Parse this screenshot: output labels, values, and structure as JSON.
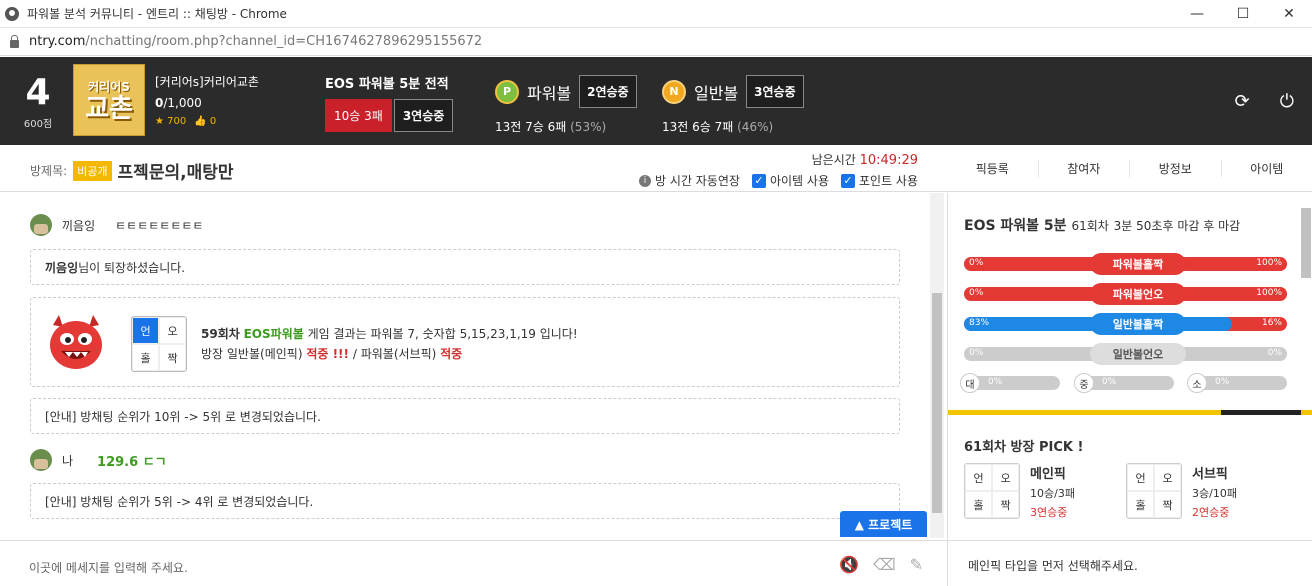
{
  "window": {
    "title": "파워볼 분석 커뮤니티 - 엔트리 :: 채팅방 - Chrome",
    "min": "—",
    "max": "☐",
    "close": "✕"
  },
  "address": {
    "host": "ntry.com",
    "path": "/nchatting/room.php?channel_id=CH1674627896295155672"
  },
  "header": {
    "rank": "4",
    "points": "600점",
    "logo_top": "커리어S",
    "logo_main": "교촌",
    "club_name": "[커리어s]커리어교촌",
    "members_cur": "0",
    "members_max": "/1,000",
    "stars": "★ 700",
    "likes": "👍 0",
    "eos_title": "EOS 파워볼 5분 전적",
    "eos_record": "10승 3패",
    "eos_streak": "3연승중",
    "pb": {
      "coin": "P",
      "label": "파워볼",
      "streak": "2연승중",
      "record": "13전 7승 6패",
      "pct": "(53%)"
    },
    "nb": {
      "coin": "N",
      "label": "일반볼",
      "streak": "3연승중",
      "record": "13전 6승 7패",
      "pct": "(46%)"
    },
    "refresh": "⟳",
    "power": "⏻"
  },
  "room": {
    "label": "방제목:",
    "tag": "비공개",
    "title": "프젝문의,매탕만",
    "time_label": "남은시간",
    "time": "10:49:29",
    "opt_auto": "방 시간 자동연장",
    "opt_item": "아이템 사용",
    "opt_point": "포인트 사용"
  },
  "tabs": [
    "픽등록",
    "참여자",
    "방정보",
    "아이템"
  ],
  "chat": {
    "m1_name": "끼음잉",
    "m1_text": "ㅌㅌㅌㅌㅌㅌㅌㅌ",
    "sys1_name": "끼음잉",
    "sys1_text": "님이 퇴장하셨습니다.",
    "res_round": "59회차",
    "res_game": "EOS파워볼",
    "res_text": "게임 결과는 파워볼 7, 숫자합 5,15,23,1,19 입니다!",
    "res_l2a": "방장 일반볼(메인픽)",
    "res_l2b": "적중 !!!",
    "res_l2c": "/ 파워볼(서브픽)",
    "res_l2d": "적중",
    "odd": [
      "언",
      "오",
      "홀",
      "짝"
    ],
    "sys2": "[안내] 방채팅 순위가 10위 -> 5위 로 변경되었습니다.",
    "m2_name": "나",
    "m2_text": "129.6 ㄷㄱ",
    "sys3": "[안내] 방채팅 순위가 5위 -> 4위 로 변경되었습니다."
  },
  "project_btn": "▲ 프로젝트",
  "input": {
    "placeholder": "이곳에 메세지를 입력해 주세요."
  },
  "side": {
    "title": "EOS 파워볼 5분",
    "round": "61회차",
    "deadline": "3분 50초후 마감 후 마감",
    "bars": [
      {
        "label": "파워볼홀짝",
        "left": "0%",
        "right": "100%",
        "value": 1.0,
        "color": "#e53935"
      },
      {
        "label": "파워볼언오",
        "left": "0%",
        "right": "100%",
        "value": 1.0,
        "color": "#e53935"
      },
      {
        "label": "일반볼홀짝",
        "left": "83%",
        "right": "16%",
        "value": 0.83,
        "color": "#1e88e5"
      },
      {
        "label": "일반볼언오",
        "left": "0%",
        "right": "0%",
        "value": 0.0,
        "color": "#ccc"
      }
    ],
    "small": [
      {
        "k": "대",
        "v": "0%"
      },
      {
        "k": "중",
        "v": "0%"
      },
      {
        "k": "소",
        "v": "0%"
      }
    ],
    "pick_title": "61회차 방장 PICK !",
    "main": {
      "name": "메인픽",
      "rec": "10승/3패",
      "streak": "3연승중"
    },
    "sub": {
      "name": "서브픽",
      "rec": "3승/10패",
      "streak": "2연승중"
    },
    "footer": "메인픽 타입을 먼저 선택해주세요."
  }
}
